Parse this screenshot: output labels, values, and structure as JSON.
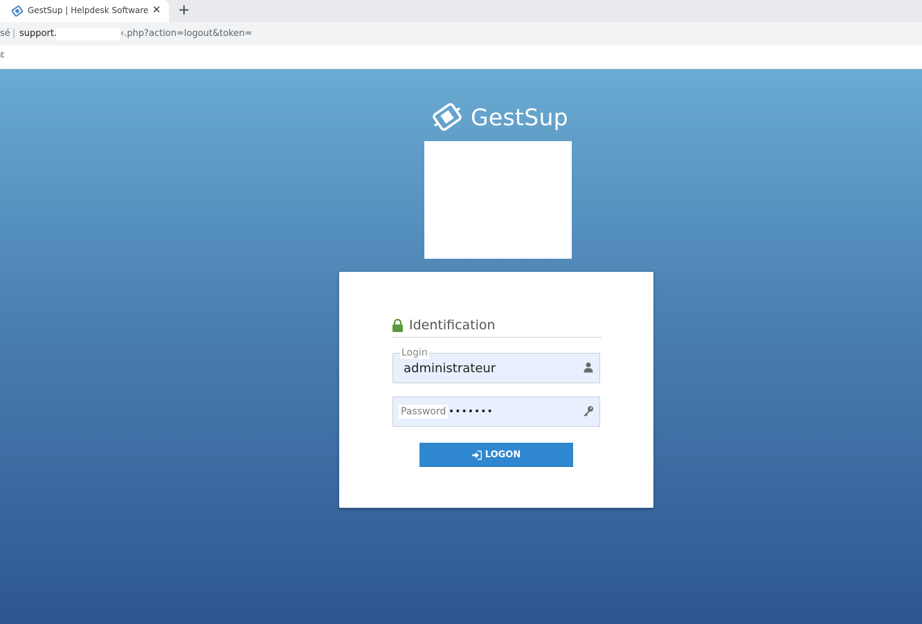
{
  "browser": {
    "tab_title": "GestSup | Helpdesk Software",
    "close_glyph": "✕",
    "new_tab_glyph": "+",
    "secure_text": "sé",
    "separator": "|",
    "url_host": "support.",
    "url_rest": "‹.php?action=logout&token=",
    "bookmark_stub": "ε"
  },
  "brand": {
    "name": "GestSup"
  },
  "login_form": {
    "title": "Identification",
    "login_label": "Login",
    "login_value": "administrateur",
    "password_placeholder": "Password",
    "password_value": "•••••••",
    "submit_label": "LOGON"
  },
  "colors": {
    "background_top": "#6aabd2",
    "background_bottom": "#2e5690",
    "button": "#2f87d0",
    "lock": "#5a9a3e",
    "field_bg": "#e8f0fe"
  },
  "icons": {
    "lock": "lock-icon",
    "user": "user-icon",
    "key": "key-icon",
    "signin": "sign-in-icon"
  }
}
